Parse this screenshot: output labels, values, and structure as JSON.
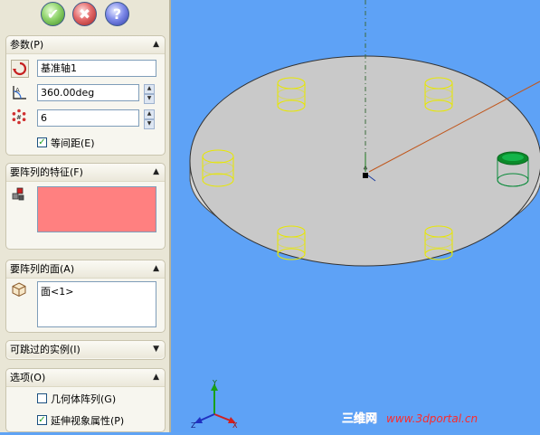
{
  "toolbar": {
    "ok_glyph": "✔",
    "cancel_glyph": "✖",
    "help_glyph": "?"
  },
  "parameters": {
    "title": "参数(P)",
    "axis_value": "基准轴1",
    "angle_value": "360.00deg",
    "instances_value": "6",
    "equal_spacing_label": "等间距(E)",
    "equal_spacing_checked": true
  },
  "features": {
    "title": "要阵列的特征(F)",
    "list_color": "#ff8080"
  },
  "faces": {
    "title": "要阵列的面(A)",
    "items": [
      "面<1>"
    ]
  },
  "skip": {
    "title": "可跳过的实例(I)"
  },
  "options": {
    "title": "选项(O)",
    "geometry_pattern_label": "几何体阵列(G)",
    "geometry_pattern_checked": false,
    "propagate_label": "延伸视象属性(P)",
    "propagate_checked": true
  },
  "viewport": {
    "background": "#5ea2f6",
    "triad": {
      "x": "X",
      "y": "Y",
      "z": "Z"
    }
  },
  "watermark": {
    "brand": "三维网",
    "url": "www.3dportal.cn"
  }
}
